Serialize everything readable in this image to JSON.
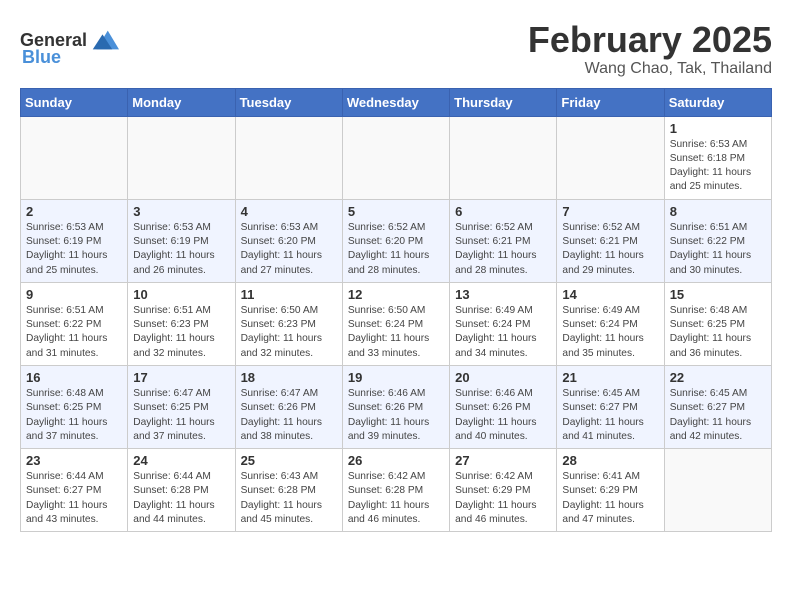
{
  "logo": {
    "general": "General",
    "blue": "Blue"
  },
  "title": "February 2025",
  "location": "Wang Chao, Tak, Thailand",
  "days_of_week": [
    "Sunday",
    "Monday",
    "Tuesday",
    "Wednesday",
    "Thursday",
    "Friday",
    "Saturday"
  ],
  "weeks": [
    {
      "alt": false,
      "days": [
        {
          "date": "",
          "info": ""
        },
        {
          "date": "",
          "info": ""
        },
        {
          "date": "",
          "info": ""
        },
        {
          "date": "",
          "info": ""
        },
        {
          "date": "",
          "info": ""
        },
        {
          "date": "",
          "info": ""
        },
        {
          "date": "1",
          "info": "Sunrise: 6:53 AM\nSunset: 6:18 PM\nDaylight: 11 hours\nand 25 minutes."
        }
      ]
    },
    {
      "alt": true,
      "days": [
        {
          "date": "2",
          "info": "Sunrise: 6:53 AM\nSunset: 6:19 PM\nDaylight: 11 hours\nand 25 minutes."
        },
        {
          "date": "3",
          "info": "Sunrise: 6:53 AM\nSunset: 6:19 PM\nDaylight: 11 hours\nand 26 minutes."
        },
        {
          "date": "4",
          "info": "Sunrise: 6:53 AM\nSunset: 6:20 PM\nDaylight: 11 hours\nand 27 minutes."
        },
        {
          "date": "5",
          "info": "Sunrise: 6:52 AM\nSunset: 6:20 PM\nDaylight: 11 hours\nand 28 minutes."
        },
        {
          "date": "6",
          "info": "Sunrise: 6:52 AM\nSunset: 6:21 PM\nDaylight: 11 hours\nand 28 minutes."
        },
        {
          "date": "7",
          "info": "Sunrise: 6:52 AM\nSunset: 6:21 PM\nDaylight: 11 hours\nand 29 minutes."
        },
        {
          "date": "8",
          "info": "Sunrise: 6:51 AM\nSunset: 6:22 PM\nDaylight: 11 hours\nand 30 minutes."
        }
      ]
    },
    {
      "alt": false,
      "days": [
        {
          "date": "9",
          "info": "Sunrise: 6:51 AM\nSunset: 6:22 PM\nDaylight: 11 hours\nand 31 minutes."
        },
        {
          "date": "10",
          "info": "Sunrise: 6:51 AM\nSunset: 6:23 PM\nDaylight: 11 hours\nand 32 minutes."
        },
        {
          "date": "11",
          "info": "Sunrise: 6:50 AM\nSunset: 6:23 PM\nDaylight: 11 hours\nand 32 minutes."
        },
        {
          "date": "12",
          "info": "Sunrise: 6:50 AM\nSunset: 6:24 PM\nDaylight: 11 hours\nand 33 minutes."
        },
        {
          "date": "13",
          "info": "Sunrise: 6:49 AM\nSunset: 6:24 PM\nDaylight: 11 hours\nand 34 minutes."
        },
        {
          "date": "14",
          "info": "Sunrise: 6:49 AM\nSunset: 6:24 PM\nDaylight: 11 hours\nand 35 minutes."
        },
        {
          "date": "15",
          "info": "Sunrise: 6:48 AM\nSunset: 6:25 PM\nDaylight: 11 hours\nand 36 minutes."
        }
      ]
    },
    {
      "alt": true,
      "days": [
        {
          "date": "16",
          "info": "Sunrise: 6:48 AM\nSunset: 6:25 PM\nDaylight: 11 hours\nand 37 minutes."
        },
        {
          "date": "17",
          "info": "Sunrise: 6:47 AM\nSunset: 6:25 PM\nDaylight: 11 hours\nand 37 minutes."
        },
        {
          "date": "18",
          "info": "Sunrise: 6:47 AM\nSunset: 6:26 PM\nDaylight: 11 hours\nand 38 minutes."
        },
        {
          "date": "19",
          "info": "Sunrise: 6:46 AM\nSunset: 6:26 PM\nDaylight: 11 hours\nand 39 minutes."
        },
        {
          "date": "20",
          "info": "Sunrise: 6:46 AM\nSunset: 6:26 PM\nDaylight: 11 hours\nand 40 minutes."
        },
        {
          "date": "21",
          "info": "Sunrise: 6:45 AM\nSunset: 6:27 PM\nDaylight: 11 hours\nand 41 minutes."
        },
        {
          "date": "22",
          "info": "Sunrise: 6:45 AM\nSunset: 6:27 PM\nDaylight: 11 hours\nand 42 minutes."
        }
      ]
    },
    {
      "alt": false,
      "days": [
        {
          "date": "23",
          "info": "Sunrise: 6:44 AM\nSunset: 6:27 PM\nDaylight: 11 hours\nand 43 minutes."
        },
        {
          "date": "24",
          "info": "Sunrise: 6:44 AM\nSunset: 6:28 PM\nDaylight: 11 hours\nand 44 minutes."
        },
        {
          "date": "25",
          "info": "Sunrise: 6:43 AM\nSunset: 6:28 PM\nDaylight: 11 hours\nand 45 minutes."
        },
        {
          "date": "26",
          "info": "Sunrise: 6:42 AM\nSunset: 6:28 PM\nDaylight: 11 hours\nand 46 minutes."
        },
        {
          "date": "27",
          "info": "Sunrise: 6:42 AM\nSunset: 6:29 PM\nDaylight: 11 hours\nand 46 minutes."
        },
        {
          "date": "28",
          "info": "Sunrise: 6:41 AM\nSunset: 6:29 PM\nDaylight: 11 hours\nand 47 minutes."
        },
        {
          "date": "",
          "info": ""
        }
      ]
    }
  ]
}
